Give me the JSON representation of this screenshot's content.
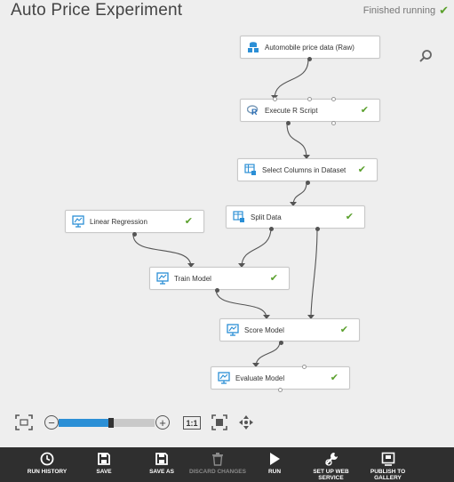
{
  "header": {
    "title": "Auto Price Experiment",
    "status": "Finished running"
  },
  "nodes": [
    {
      "id": "automobile",
      "label": "Automobile price data (Raw)",
      "icon": "dataset-icon",
      "check": false
    },
    {
      "id": "execute_r",
      "label": "Execute R Script",
      "icon": "r-script-icon",
      "check": true
    },
    {
      "id": "select_cols",
      "label": "Select Columns in Dataset",
      "icon": "table-columns-icon",
      "check": true
    },
    {
      "id": "split",
      "label": "Split Data",
      "icon": "table-split-icon",
      "check": true
    },
    {
      "id": "linreg",
      "label": "Linear Regression",
      "icon": "model-icon",
      "check": true
    },
    {
      "id": "train",
      "label": "Train Model",
      "icon": "model-icon",
      "check": true
    },
    {
      "id": "score",
      "label": "Score Model",
      "icon": "model-icon",
      "check": true
    },
    {
      "id": "evaluate",
      "label": "Evaluate Model",
      "icon": "model-icon",
      "check": true
    }
  ],
  "zoom": {
    "level": 0.55,
    "one_to_one_label": "1:1"
  },
  "toolbar": {
    "run_history": "RUN HISTORY",
    "save": "SAVE",
    "save_as": "SAVE AS",
    "discard": "DISCARD CHANGES",
    "run": "RUN",
    "setup_web_l1": "SET UP WEB",
    "setup_web_l2": "SERVICE",
    "publish_l1": "PUBLISH TO",
    "publish_l2": "GALLERY"
  },
  "colors": {
    "accent": "#2b8fd6",
    "success": "#5aa02c",
    "toolbar_bg": "#2f2f2f"
  }
}
